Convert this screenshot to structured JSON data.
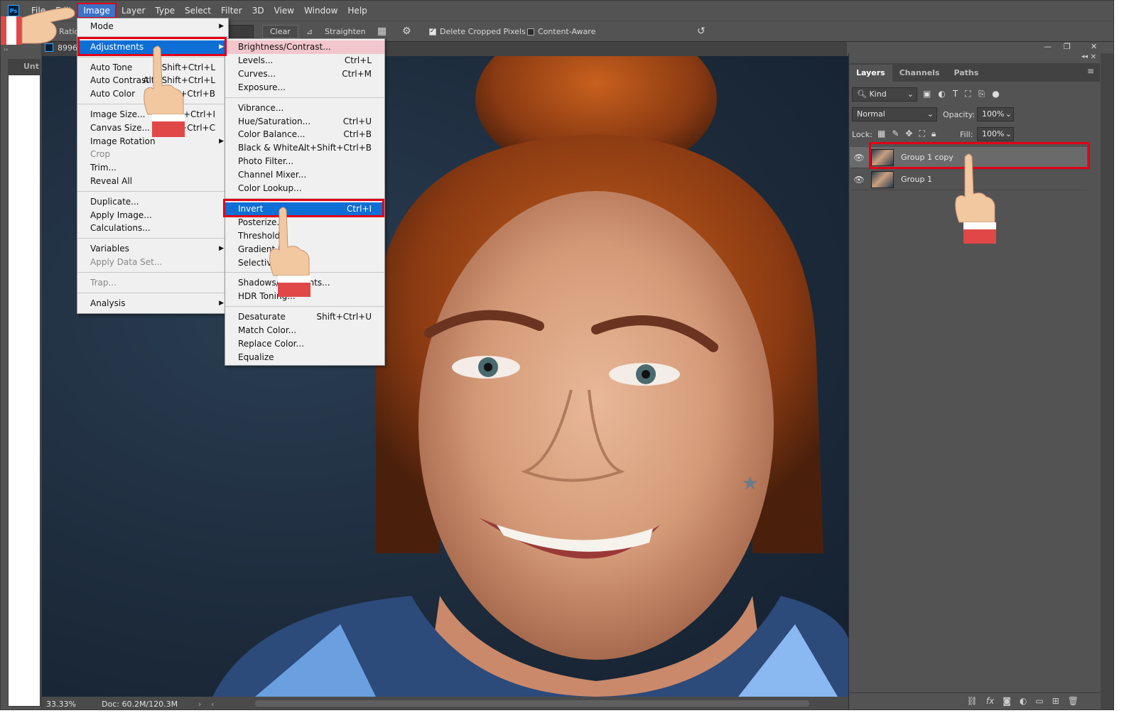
{
  "menubar": {
    "items": [
      "File",
      "Edit",
      "Image",
      "Layer",
      "Type",
      "Select",
      "Filter",
      "3D",
      "View",
      "Window",
      "Help"
    ],
    "active": "Image",
    "logo": "Ps"
  },
  "options": {
    "ratio_label": "Ratio",
    "clear_label": "Clear",
    "straighten_label": "Straighten",
    "delete_cropped_label": "Delete Cropped Pixels",
    "content_aware_label": "Content-Aware"
  },
  "document": {
    "tab_label": "8996",
    "side_tab_label": "Unt"
  },
  "status": {
    "zoom": "33.33%",
    "doc": "Doc: 60.2M/120.3M"
  },
  "image_menu": [
    {
      "label": "Mode",
      "shortcut": "",
      "submenu": true,
      "disabled": false
    },
    {
      "sep": true
    },
    {
      "label": "Adjustments",
      "shortcut": "",
      "submenu": true,
      "disabled": false,
      "highlight": true
    },
    {
      "sep": true
    },
    {
      "label": "Auto Tone",
      "shortcut": "Shift+Ctrl+L",
      "submenu": false,
      "disabled": false
    },
    {
      "label": "Auto Contrast",
      "shortcut": "Alt+Shift+Ctrl+L",
      "submenu": false,
      "disabled": false
    },
    {
      "label": "Auto Color",
      "shortcut": "Shift+Ctrl+B",
      "submenu": false,
      "disabled": false
    },
    {
      "sep": true
    },
    {
      "label": "Image Size...",
      "shortcut": "Alt+Ctrl+I",
      "submenu": false,
      "disabled": false
    },
    {
      "label": "Canvas Size...",
      "shortcut": "Alt+Ctrl+C",
      "submenu": false,
      "disabled": false
    },
    {
      "label": "Image Rotation",
      "shortcut": "",
      "submenu": true,
      "disabled": false
    },
    {
      "label": "Crop",
      "shortcut": "",
      "submenu": false,
      "disabled": true
    },
    {
      "label": "Trim...",
      "shortcut": "",
      "submenu": false,
      "disabled": false
    },
    {
      "label": "Reveal All",
      "shortcut": "",
      "submenu": false,
      "disabled": false
    },
    {
      "sep": true
    },
    {
      "label": "Duplicate...",
      "shortcut": "",
      "submenu": false,
      "disabled": false
    },
    {
      "label": "Apply Image...",
      "shortcut": "",
      "submenu": false,
      "disabled": false
    },
    {
      "label": "Calculations...",
      "shortcut": "",
      "submenu": false,
      "disabled": false
    },
    {
      "sep": true
    },
    {
      "label": "Variables",
      "shortcut": "",
      "submenu": true,
      "disabled": false
    },
    {
      "label": "Apply Data Set...",
      "shortcut": "",
      "submenu": false,
      "disabled": true
    },
    {
      "sep": true
    },
    {
      "label": "Trap...",
      "shortcut": "",
      "submenu": false,
      "disabled": true
    },
    {
      "sep": true
    },
    {
      "label": "Analysis",
      "shortcut": "",
      "submenu": true,
      "disabled": false
    }
  ],
  "adjust_menu": [
    {
      "label": "Brightness/Contrast...",
      "shortcut": "",
      "pink": true
    },
    {
      "label": "Levels...",
      "shortcut": "Ctrl+L"
    },
    {
      "label": "Curves...",
      "shortcut": "Ctrl+M"
    },
    {
      "label": "Exposure...",
      "shortcut": ""
    },
    {
      "sep": true
    },
    {
      "label": "Vibrance...",
      "shortcut": ""
    },
    {
      "label": "Hue/Saturation...",
      "shortcut": "Ctrl+U"
    },
    {
      "label": "Color Balance...",
      "shortcut": "Ctrl+B"
    },
    {
      "label": "Black & White...",
      "shortcut": "Alt+Shift+Ctrl+B"
    },
    {
      "label": "Photo Filter...",
      "shortcut": ""
    },
    {
      "label": "Channel Mixer...",
      "shortcut": ""
    },
    {
      "label": "Color Lookup...",
      "shortcut": ""
    },
    {
      "sep": true
    },
    {
      "label": "Invert",
      "shortcut": "Ctrl+I",
      "highlight": true
    },
    {
      "label": "Posterize...",
      "shortcut": ""
    },
    {
      "label": "Threshold...",
      "shortcut": ""
    },
    {
      "label": "Gradient Map...",
      "shortcut": ""
    },
    {
      "label": "Selective Color...",
      "shortcut": ""
    },
    {
      "sep": true
    },
    {
      "label": "Shadows/Highlights...",
      "shortcut": ""
    },
    {
      "label": "HDR Toning...",
      "shortcut": ""
    },
    {
      "sep": true
    },
    {
      "label": "Desaturate",
      "shortcut": "Shift+Ctrl+U"
    },
    {
      "label": "Match Color...",
      "shortcut": ""
    },
    {
      "label": "Replace Color...",
      "shortcut": ""
    },
    {
      "label": "Equalize",
      "shortcut": ""
    }
  ],
  "layers_panel": {
    "tabs": [
      "Layers",
      "Channels",
      "Paths"
    ],
    "filter_kind": "Kind",
    "blend_mode": "Normal",
    "opacity_label": "Opacity:",
    "opacity_value": "100%",
    "lock_label": "Lock:",
    "fill_label": "Fill:",
    "fill_value": "100%",
    "layers": [
      {
        "name": "Group 1 copy",
        "selected": true
      },
      {
        "name": "Group 1",
        "selected": false
      }
    ],
    "bottom_icons": [
      "link-icon",
      "fx-icon",
      "mask-icon",
      "adjustment-icon",
      "folder-icon",
      "new-layer-icon",
      "trash-icon"
    ]
  },
  "colors": {
    "highlight_box": "#e10016",
    "menu_select": "#0d6fd6",
    "ui_bg": "#535353"
  }
}
